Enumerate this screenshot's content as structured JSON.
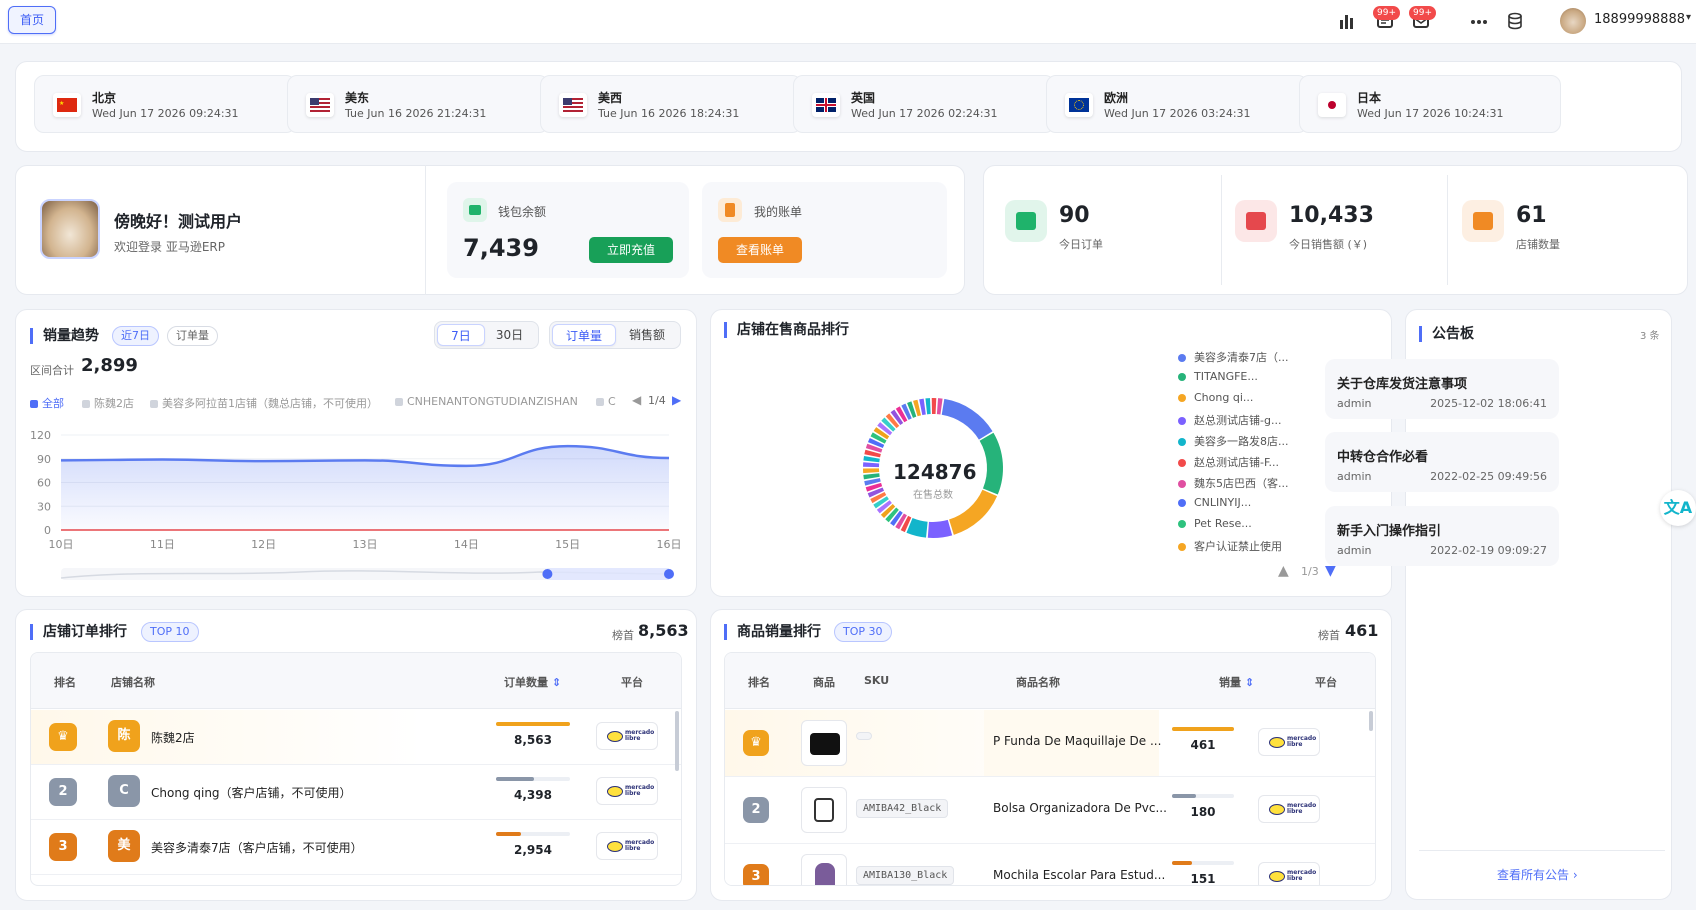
{
  "header": {
    "home_tab": "首页",
    "badge1": "99+",
    "badge2": "99+",
    "phone": "18899998888"
  },
  "clocks": [
    {
      "city": "北京",
      "time": "Wed Jun 17 2026 09:24:31",
      "flag": "cn"
    },
    {
      "city": "美东",
      "time": "Tue Jun 16 2026 21:24:31",
      "flag": "us"
    },
    {
      "city": "美西",
      "time": "Tue Jun 16 2026 18:24:31",
      "flag": "us"
    },
    {
      "city": "英国",
      "time": "Wed Jun 17 2026 02:24:31",
      "flag": "uk"
    },
    {
      "city": "欧洲",
      "time": "Wed Jun 17 2026 03:24:31",
      "flag": "eu"
    },
    {
      "city": "日本",
      "time": "Wed Jun 17 2026 10:24:31",
      "flag": "jp"
    }
  ],
  "welcome": {
    "greeting": "傍晚好！测试用户",
    "sub": "欢迎登录 亚马逊ERP"
  },
  "wallet": {
    "label": "钱包余额",
    "amount": "7,439",
    "button": "立即充值"
  },
  "bill": {
    "label": "我的账单",
    "button": "查看账单"
  },
  "stats": [
    {
      "value": "90",
      "label": "今日订单",
      "color": "#1fb36b",
      "icon": "cart-icon"
    },
    {
      "value": "10,433",
      "label": "今日销售额 (￥)",
      "color": "#e5484d",
      "icon": "truck-icon"
    },
    {
      "value": "61",
      "label": "店铺数量",
      "color": "#f08a24",
      "icon": "store-icon"
    }
  ],
  "sales_trend": {
    "title": "销量趋势",
    "pill_range": "近7日",
    "pill_metric": "订单量",
    "seg_days": [
      "7日",
      "30日"
    ],
    "seg_metric": [
      "订单量",
      "销售额"
    ],
    "total_label": "区间合计",
    "total_value": "2,899",
    "legend": [
      "全部",
      "陈魏2店",
      "美容多阿拉苗1店铺（魏总店铺，不可使用）",
      "CNHENANTONGTUDIANZISHAN",
      "C"
    ],
    "legend_page": "1/4"
  },
  "chart_data": {
    "type": "area",
    "x": [
      "10日",
      "11日",
      "12日",
      "13日",
      "14日",
      "15日",
      "16日"
    ],
    "ylim": [
      0,
      120
    ],
    "yticks": [
      0,
      30,
      60,
      90,
      120
    ],
    "series": [
      {
        "name": "全部",
        "values": [
          88,
          89,
          87,
          88,
          81,
          106,
          91
        ],
        "color": "#5b7bf0"
      },
      {
        "name": "陈魏2店",
        "values": [
          0,
          0,
          0,
          0,
          0,
          0,
          0
        ],
        "color": "#e5484d"
      }
    ]
  },
  "shop_products": {
    "title": "店铺在售商品排行",
    "center_value": "124876",
    "center_label": "在售总数",
    "legend": [
      {
        "name": "美容多清泰7店（...",
        "color": "#5b7bf0"
      },
      {
        "name": "TITANGFE...",
        "color": "#26b37a"
      },
      {
        "name": "Chong qi...",
        "color": "#f5a623"
      },
      {
        "name": "赵总测试店铺-g...",
        "color": "#7b61ff"
      },
      {
        "name": "美容多一路发8店...",
        "color": "#12b5cb"
      },
      {
        "name": "赵总测试店铺-F...",
        "color": "#f24a4a"
      },
      {
        "name": "魏东5店巴西（客...",
        "color": "#e04fa1"
      },
      {
        "name": "CNLINYIJ...",
        "color": "#4f6ef7"
      },
      {
        "name": "Pet Rese...",
        "color": "#2ec27e"
      },
      {
        "name": "客户认证禁止使用",
        "color": "#f5a623"
      }
    ],
    "page": "1/3"
  },
  "notice_board": {
    "title": "公告板",
    "count": "3 条",
    "items": [
      {
        "title": "关于仓库发货注意事项",
        "author": "admin",
        "date": "2025-12-02 18:06:41"
      },
      {
        "title": "中转仓合作必看",
        "author": "admin",
        "date": "2022-02-25 09:49:56"
      },
      {
        "title": "新手入门操作指引",
        "author": "admin",
        "date": "2022-02-19 09:09:27"
      }
    ],
    "link": "查看所有公告 ›"
  },
  "shop_orders": {
    "title": "店铺订单排行",
    "pill": "TOP 10",
    "top_label": "榜首",
    "top_value": "8,563",
    "headers": [
      "排名",
      "店铺名称",
      "订单数量",
      "平台"
    ],
    "rows": [
      {
        "rank": "1",
        "avatar": "陈",
        "name": "陈魏2店",
        "orders": "8,563",
        "pct": 1.0,
        "color": "#f0a21c"
      },
      {
        "rank": "2",
        "avatar": "C",
        "name": "Chong qing（客户店铺，不可使用）",
        "orders": "4,398",
        "pct": 0.51,
        "color": "#8a96a8"
      },
      {
        "rank": "3",
        "avatar": "美",
        "name": "美容多清泰7店（客户店铺，不可使用）",
        "orders": "2,954",
        "pct": 0.34,
        "color": "#e07b1a"
      }
    ]
  },
  "product_sales": {
    "title": "商品销量排行",
    "pill": "TOP 30",
    "top_label": "榜首",
    "top_value": "461",
    "headers": [
      "排名",
      "商品",
      "SKU",
      "商品名称",
      "销量",
      "平台"
    ],
    "rows": [
      {
        "rank": "1",
        "sku": "",
        "name": "P Funda De Maquillaje De ...",
        "sales": "461",
        "pct": 1.0,
        "color": "#f0a21c"
      },
      {
        "rank": "2",
        "sku": "AMIBA42_Black",
        "name": "Bolsa Organizadora De Pvc...",
        "sales": "180",
        "pct": 0.39,
        "color": "#8a96a8"
      },
      {
        "rank": "3",
        "sku": "AMIBA130_Black",
        "name": "Mochila Escolar Para Estud...",
        "sales": "151",
        "pct": 0.33,
        "color": "#e07b1a"
      }
    ]
  }
}
